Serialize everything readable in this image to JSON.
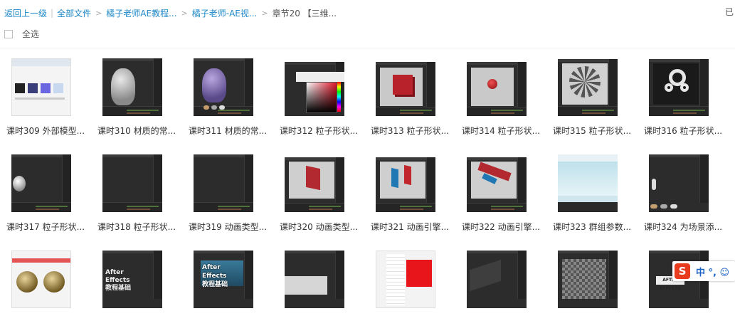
{
  "breadcrumb": {
    "back": "返回上一级",
    "all_files": "全部文件",
    "level1": "橘子老师AE教程...",
    "level2": "橘子老师-AE视...",
    "current": "章节20 【三维..."
  },
  "right_edge_text": "已",
  "select_all": "全选",
  "ime": {
    "logo": "S",
    "text": "中 °, ☺"
  },
  "rows": [
    [
      "课时309 外部模型...",
      "课时310 材质的常...",
      "课时311 材质的常...",
      "课时312 粒子形状...",
      "课时313 粒子形状...",
      "课时314 粒子形状...",
      "课时315 粒子形状...",
      "课时316 粒子形状..."
    ],
    [
      "课时317 粒子形状...",
      "课时318 粒子形状...",
      "课时319 动画类型...",
      "课时320 动画类型...",
      "课时321 动画引擎...",
      "课时322 动画引擎...",
      "课时323 群组参数...",
      "课时324 为场景添..."
    ],
    [
      "",
      "",
      "",
      "",
      "",
      "",
      "",
      ""
    ]
  ],
  "thumb_texts": {
    "ae1": "After Effects",
    "ae2": "教程基础",
    "ae3": "After Effects",
    "ae4": "教程基础",
    "ae5": "AFTER EFFECTS"
  }
}
